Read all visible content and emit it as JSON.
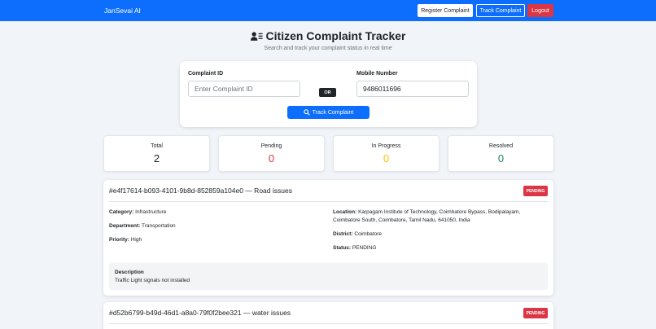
{
  "navbar": {
    "brand": "JanSevai AI",
    "register_label": "Register Complaint",
    "track_label": "Track Complaint",
    "logout_label": "Logout"
  },
  "header": {
    "title": "Citizen Complaint Tracker",
    "subtitle": "Search and track your complaint status in real time",
    "icon": "user-list-icon"
  },
  "search": {
    "complaint_id_label": "Complaint ID",
    "complaint_id_placeholder": "Enter Complaint ID",
    "complaint_id_value": "",
    "or_label": "OR",
    "mobile_label": "Mobile Number",
    "mobile_value": "9486011696",
    "button_label": "Track Complaint",
    "button_icon": "search-icon"
  },
  "stats": [
    {
      "label": "Total",
      "value": "2",
      "color": "#212529"
    },
    {
      "label": "Pending",
      "value": "0",
      "color": "#dc3545"
    },
    {
      "label": "In Progress",
      "value": "0",
      "color": "#ffc107"
    },
    {
      "label": "Resolved",
      "value": "0",
      "color": "#198754"
    }
  ],
  "complaints": [
    {
      "title": "#e4f17614-b093-4101-9b8d-852859a104e0 — Road issues",
      "badge": "PENDING",
      "category_label": "Category:",
      "category": "Infrastructure",
      "department_label": "Department:",
      "department": "Transportation",
      "priority_label": "Priority:",
      "priority": "High",
      "location_label": "Location:",
      "location": "Karpagam Institute of Technology, Coimbatore Bypass, Bodipalayam, Coimbatore South, Coimbatore, Tamil Nadu, 641050, India",
      "district_label": "District:",
      "district": "Coimbatore",
      "status_label": "Status:",
      "status": "PENDING",
      "description_label": "Description",
      "description": "Traffic Light signals not installed"
    },
    {
      "title": "#d52b6799-b49d-46d1-a8a0-79f0f2bee321 — water issues",
      "badge": "PENDING"
    }
  ],
  "colors": {
    "primary": "#0d6efd",
    "danger": "#dc3545",
    "warning": "#ffc107",
    "success": "#198754"
  }
}
